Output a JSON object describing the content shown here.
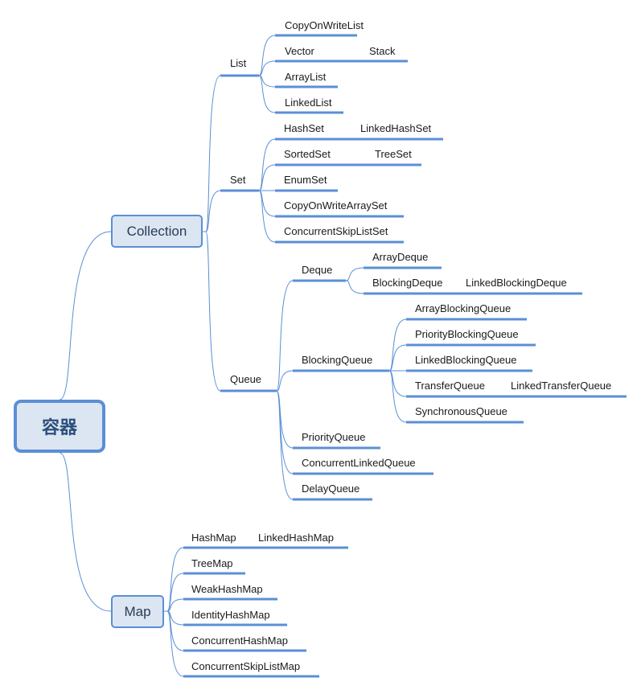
{
  "colors": {
    "line": "#5b8fd6",
    "box_fill": "#dce6f2",
    "box_border": "#5a8fd4",
    "text": "#1a1a1a"
  },
  "root": {
    "label": "容器"
  },
  "collection": {
    "label": "Collection",
    "list": {
      "label": "List",
      "items": [
        {
          "label": "CopyOnWriteList"
        },
        {
          "label": "Vector",
          "sub": "Stack"
        },
        {
          "label": "ArrayList"
        },
        {
          "label": "LinkedList"
        }
      ]
    },
    "set": {
      "label": "Set",
      "items": [
        {
          "label": "HashSet",
          "sub": "LinkedHashSet"
        },
        {
          "label": "SortedSet",
          "sub": "TreeSet"
        },
        {
          "label": "EnumSet"
        },
        {
          "label": "CopyOnWriteArraySet"
        },
        {
          "label": "ConcurrentSkipListSet"
        }
      ]
    },
    "queue": {
      "label": "Queue",
      "deque": {
        "label": "Deque",
        "items": [
          {
            "label": "ArrayDeque"
          },
          {
            "label": "BlockingDeque",
            "sub": "LinkedBlockingDeque"
          }
        ]
      },
      "blocking_queue": {
        "label": "BlockingQueue",
        "items": [
          {
            "label": "ArrayBlockingQueue"
          },
          {
            "label": "PriorityBlockingQueue"
          },
          {
            "label": "LinkedBlockingQueue"
          },
          {
            "label": "TransferQueue",
            "sub": "LinkedTransferQueue"
          },
          {
            "label": "SynchronousQueue"
          }
        ]
      },
      "items": [
        {
          "label": "PriorityQueue"
        },
        {
          "label": "ConcurrentLinkedQueue"
        },
        {
          "label": "DelayQueue"
        }
      ]
    }
  },
  "map": {
    "label": "Map",
    "items": [
      {
        "label": "HashMap",
        "sub": "LinkedHashMap"
      },
      {
        "label": "TreeMap"
      },
      {
        "label": "WeakHashMap"
      },
      {
        "label": "IdentityHashMap"
      },
      {
        "label": "ConcurrentHashMap"
      },
      {
        "label": "ConcurrentSkipListMap"
      }
    ]
  }
}
